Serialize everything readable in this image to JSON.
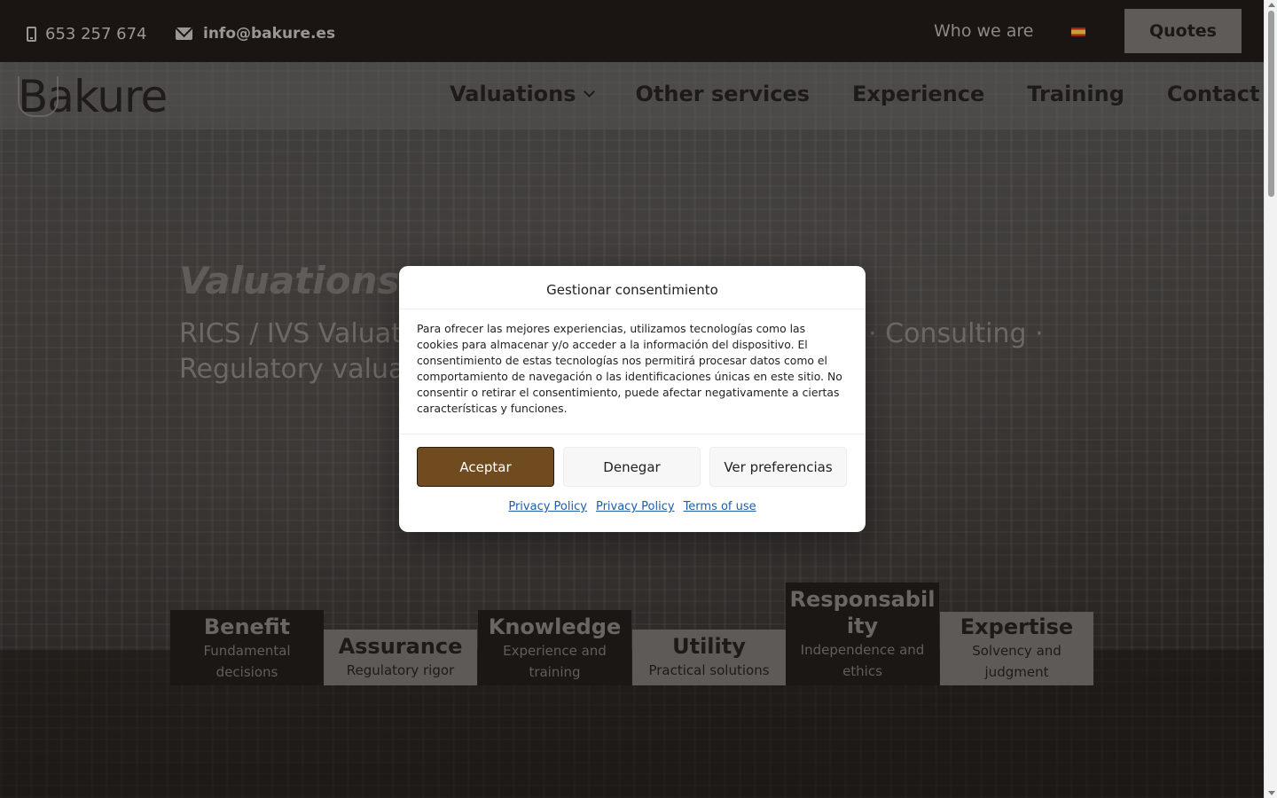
{
  "topbar": {
    "phone": "653 257 674",
    "email": "info@bakure.es",
    "who_we_are": "Who we are",
    "language_flag": "spain-flag-icon",
    "quotes_label": "Quotes"
  },
  "header": {
    "logo_text": "Bakure",
    "nav": [
      {
        "label": "Valuations"
      },
      {
        "label": "Other services"
      },
      {
        "label": "Experience"
      },
      {
        "label": "Training"
      },
      {
        "label": "Contact"
      }
    ]
  },
  "hero": {
    "title": "Valuations",
    "subtitle": "RICS / IVS Valuations · Valuations and land analysis · Consulting · Regulatory valuations · Training"
  },
  "values": [
    {
      "title": "Benefit",
      "subtitle": "Fundamental decisions"
    },
    {
      "title": "Assurance",
      "subtitle": "Regulatory rigor"
    },
    {
      "title": "Knowledge",
      "subtitle": "Experience and training"
    },
    {
      "title": "Utility",
      "subtitle": "Practical solutions"
    },
    {
      "title": "Responsability",
      "subtitle": "Independence and ethics"
    },
    {
      "title": "Expertise",
      "subtitle": "Solvency and judgment"
    }
  ],
  "consent": {
    "title": "Gestionar consentimiento",
    "body": "Para ofrecer las mejores experiencias, utilizamos tecnologías como las cookies para almacenar y/o acceder a la información del dispositivo. El consentimiento de estas tecnologías nos permitirá procesar datos como el comportamiento de navegación o las identificaciones únicas en este sitio. No consentir o retirar el consentimiento, puede afectar negativamente a ciertas características y funciones.",
    "accept": "Aceptar",
    "deny": "Denegar",
    "preferences": "Ver preferencias",
    "links": [
      "Privacy Policy",
      "Privacy Policy",
      "Terms of use"
    ]
  },
  "colors": {
    "accent_brown": "#6f4b1f",
    "topbar_bg": "#1a1412",
    "link_blue": "#1f5da8"
  }
}
